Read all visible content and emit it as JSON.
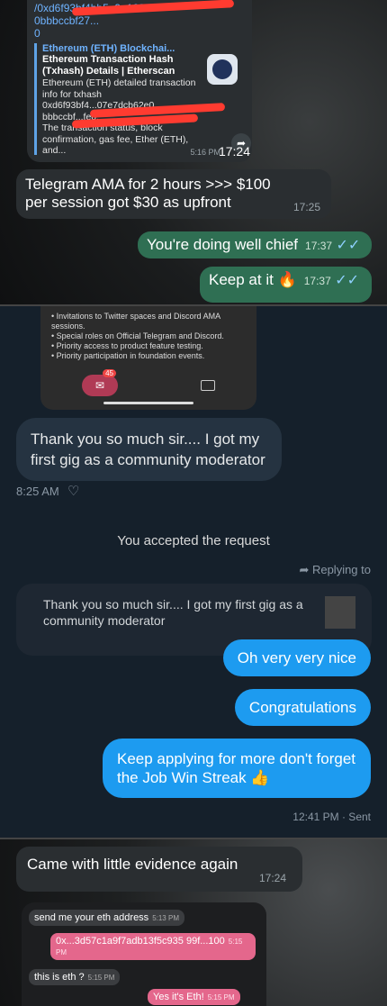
{
  "p1": {
    "link_lines": [
      "/0xd6f93bf4bb5a9a163...",
      "0bbbccbf27...",
      "0"
    ],
    "preview": {
      "site": "Ethereum (ETH) Blockchai...",
      "title": "Ethereum Transaction Hash (Txhash) Details | Etherscan",
      "desc1": "Ethereum (ETH) detailed transaction info for txhash",
      "desc2": "0xd6f93bf4...07e7dcb62e0",
      "desc3": "bbbccbf...fe0.",
      "desc4": "The transaction status, block confirmation, gas fee, Ether (ETH), and..."
    },
    "preview_meta": "5:16 PM",
    "preview_time": "17:24",
    "msg_in": {
      "text": "Telegram AMA for 2 hours >>> $100 per session got $30 as upfront",
      "time": "17:25"
    },
    "msg_out1": {
      "text": "You're doing well chief",
      "time": "17:37"
    },
    "msg_out2": {
      "text": "Keep at it 🔥",
      "time": "17:37"
    }
  },
  "p2": {
    "card_items": [
      "Invitations to Twitter spaces and Discord AMA sessions.",
      "Special roles on Official Telegram and Discord.",
      "Priority access to product feature testing.",
      "Priority participation in foundation events."
    ],
    "badge": "45",
    "received": "Thank you so much sir.... I got my first gig as a community moderator",
    "received_time": "8:25 AM",
    "accepted": "You accepted the request",
    "replying": "Replying to",
    "reply_text": "Thank you so much sir.... I got my first gig as a community moderator",
    "sent1": "Oh very very nice",
    "sent2": "Congratulations",
    "sent3": "Keep applying for more don't forget the Job Win Streak 👍",
    "sent_time": "12:41 PM · Sent"
  },
  "p3": {
    "msg_in": {
      "text": "Came with little evidence again",
      "time": "17:24"
    },
    "shot": [
      {
        "text": "send me your eth address",
        "time": "5:13 PM"
      },
      {
        "text": "0x...3d57c1a9f7adb13f5c935 99f...100",
        "time": "5:15 PM"
      },
      {
        "text": "this is eth ?",
        "time": "5:15 PM"
      },
      {
        "text": "Yes it's Eth!",
        "time": "5:15 PM"
      }
    ]
  }
}
